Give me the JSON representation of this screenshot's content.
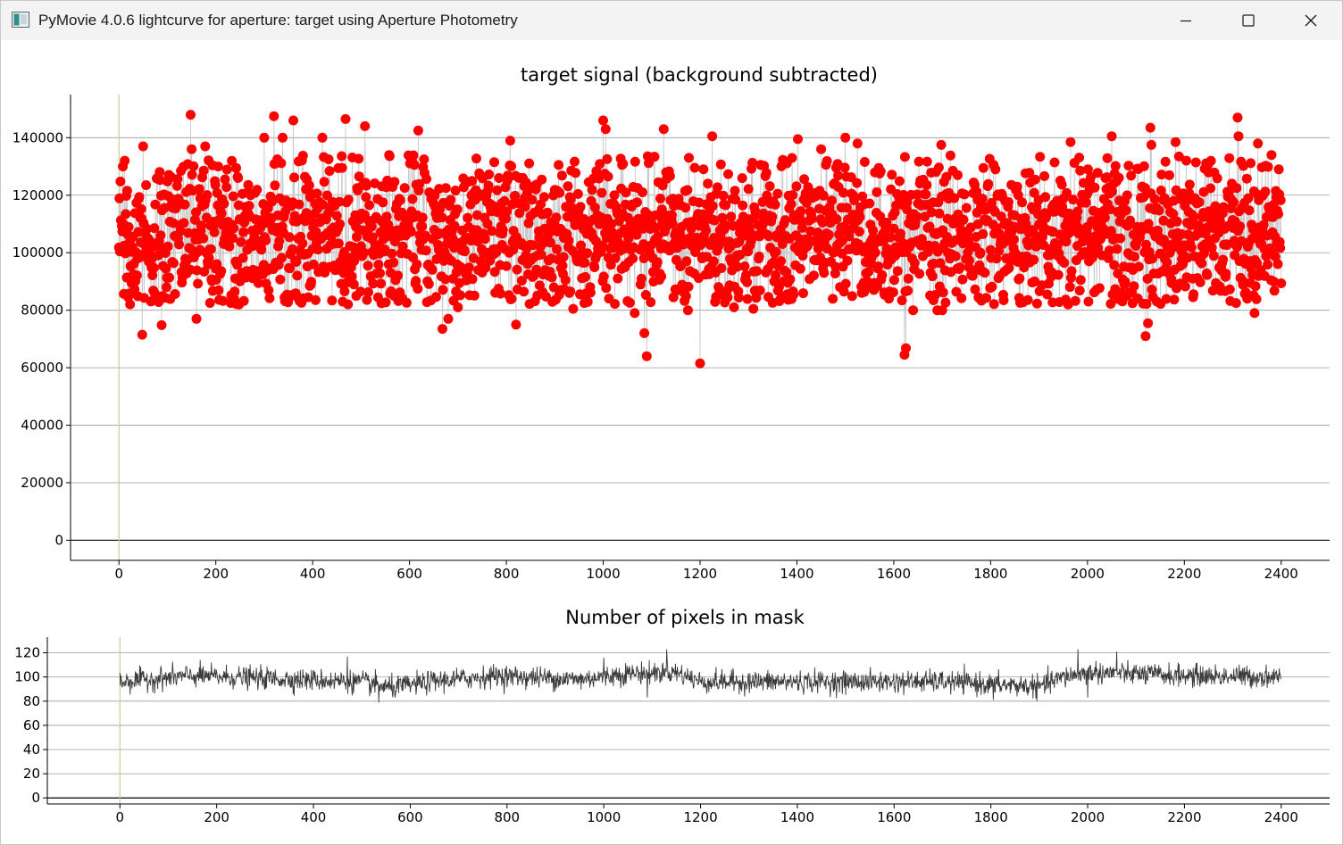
{
  "window": {
    "title": "PyMovie 4.0.6 lightcurve for aperture: target using Aperture Photometry"
  },
  "colors": {
    "marker": "#ff0000",
    "connector": "#c8c8c8",
    "pixel_line": "#3a3a3a",
    "cursor_line": "#c6d08a",
    "grid": "#9a9a9a",
    "axis": "#000000"
  },
  "icons": {
    "app": "pymovie-app-icon",
    "minimize": "minimize-icon",
    "maximize": "maximize-icon",
    "close": "close-icon"
  },
  "chart_data": [
    {
      "type": "scatter",
      "title": "target signal (background subtracted)",
      "xlabel": "",
      "ylabel": "",
      "xlim": [
        -100,
        2500
      ],
      "ylim": [
        -7000,
        155000
      ],
      "xticks": [
        "0",
        "200",
        "400",
        "600",
        "800",
        "1000",
        "1200",
        "1400",
        "1600",
        "1800",
        "2000",
        "2200",
        "2400"
      ],
      "yticks": [
        "0",
        "20000",
        "40000",
        "60000",
        "80000",
        "100000",
        "120000",
        "140000"
      ],
      "grid": true,
      "connected": true,
      "cursor_x": 0,
      "series": [
        {
          "x_range": [
            0,
            2400
          ],
          "mean": 106000,
          "std": 13500,
          "values": [
            [
              8,
              130000
            ],
            [
              12,
              132000
            ],
            [
              48,
              71500
            ],
            [
              50,
              137000
            ],
            [
              88,
              74800
            ],
            [
              148,
              148000
            ],
            [
              150,
              136000
            ],
            [
              160,
              77000
            ],
            [
              178,
              137000
            ],
            [
              205,
              130000
            ],
            [
              248,
              82000
            ],
            [
              300,
              140000
            ],
            [
              320,
              147500
            ],
            [
              338,
              140000
            ],
            [
              360,
              146000
            ],
            [
              420,
              140000
            ],
            [
              462,
              83000
            ],
            [
              468,
              146500
            ],
            [
              490,
              85000
            ],
            [
              508,
              144000
            ],
            [
              535,
              84500
            ],
            [
              618,
              142500
            ],
            [
              668,
              73500
            ],
            [
              680,
              77000
            ],
            [
              700,
              81000
            ],
            [
              808,
              139000
            ],
            [
              820,
              75000
            ],
            [
              938,
              80500
            ],
            [
              1000,
              146000
            ],
            [
              1005,
              143000
            ],
            [
              1065,
              79000
            ],
            [
              1085,
              72000
            ],
            [
              1090,
              64000
            ],
            [
              1125,
              143000
            ],
            [
              1175,
              80000
            ],
            [
              1200,
              61500
            ],
            [
              1225,
              140500
            ],
            [
              1270,
              81000
            ],
            [
              1310,
              80500
            ],
            [
              1402,
              139500
            ],
            [
              1450,
              136000
            ],
            [
              1500,
              140000
            ],
            [
              1525,
              138000
            ],
            [
              1622,
              64500
            ],
            [
              1625,
              66800
            ],
            [
              1640,
              80000
            ],
            [
              1690,
              80000
            ],
            [
              1698,
              137500
            ],
            [
              1700,
              80000
            ],
            [
              1810,
              129000
            ],
            [
              1960,
              82000
            ],
            [
              1965,
              138500
            ],
            [
              2050,
              140500
            ],
            [
              2120,
              71000
            ],
            [
              2125,
              75500
            ],
            [
              2130,
              143500
            ],
            [
              2132,
              137500
            ],
            [
              2182,
              138500
            ],
            [
              2310,
              147000
            ],
            [
              2312,
              140500
            ],
            [
              2345,
              79000
            ],
            [
              2352,
              138000
            ],
            [
              2380,
              134000
            ],
            [
              2395,
              129000
            ]
          ]
        }
      ]
    },
    {
      "type": "line",
      "title": "Number of pixels in mask",
      "xlabel": "",
      "ylabel": "",
      "xlim": [
        -150,
        2500
      ],
      "ylim": [
        -5,
        133
      ],
      "xticks": [
        "0",
        "200",
        "400",
        "600",
        "800",
        "1000",
        "1200",
        "1400",
        "1600",
        "1800",
        "2000",
        "2200",
        "2400"
      ],
      "yticks": [
        "0",
        "20",
        "40",
        "60",
        "80",
        "100",
        "120"
      ],
      "grid": true,
      "cursor_x": 0,
      "series": [
        {
          "x_range": [
            0,
            2400
          ],
          "levels": [
            [
              0,
              96
            ],
            [
              150,
              101
            ],
            [
              500,
              96
            ],
            [
              560,
              91
            ],
            [
              660,
              97
            ],
            [
              780,
              101
            ],
            [
              950,
              98
            ],
            [
              1050,
              103
            ],
            [
              1150,
              104
            ],
            [
              1200,
              96
            ],
            [
              1500,
              96
            ],
            [
              1700,
              96
            ],
            [
              1800,
              94
            ],
            [
              1900,
              92
            ],
            [
              1950,
              100
            ],
            [
              2000,
              104
            ],
            [
              2200,
              101
            ],
            [
              2400,
              100
            ]
          ],
          "std": 6,
          "values": [
            [
              470,
              117
            ],
            [
              535,
              79
            ],
            [
              1000,
              116
            ],
            [
              1090,
              123
            ],
            [
              1130,
              123
            ],
            [
              1090,
              83
            ],
            [
              1805,
              81
            ],
            [
              1895,
              80
            ],
            [
              1980,
              123
            ],
            [
              2060,
              121
            ],
            [
              2000,
              83
            ]
          ]
        }
      ]
    }
  ]
}
